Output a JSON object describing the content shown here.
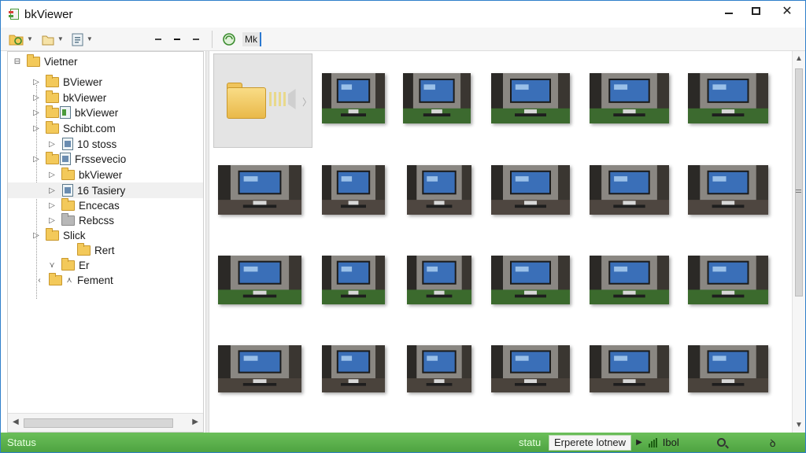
{
  "window": {
    "title": "bkViewer",
    "controls": {
      "close": "✕"
    }
  },
  "toolbar": {
    "address": "Mk"
  },
  "tree": {
    "items": [
      {
        "label": "Vietner",
        "icon": "folder"
      },
      {
        "label": "BViewer",
        "icon": "folder"
      },
      {
        "label": "bkViewer",
        "icon": "folder"
      },
      {
        "label": "bkViewer",
        "icon": "file"
      },
      {
        "label": "Schibt.com",
        "icon": "folder"
      },
      {
        "label": "10 stoss",
        "icon": "file"
      },
      {
        "label": "Frssevecio",
        "icon": "file"
      },
      {
        "label": "bkViewer",
        "icon": "folder"
      },
      {
        "label": "16 Tasiery",
        "icon": "file"
      },
      {
        "label": "Encecas",
        "icon": "folder"
      },
      {
        "label": "Rebcss",
        "icon": "folder"
      },
      {
        "label": "Slick",
        "icon": "folder"
      },
      {
        "label": "Rert",
        "icon": "folder"
      },
      {
        "label": "Er",
        "icon": "folder"
      },
      {
        "label": "Fement",
        "icon": "folder"
      }
    ]
  },
  "thumbnails": {
    "count": 24,
    "first_is_folder": true,
    "accent": "#3a6fb8"
  },
  "statusbar": {
    "left": "Status",
    "right_label": "statu",
    "field": "Erperete lotnew",
    "zoom": "Ibol",
    "pin": "ꝺ",
    "grip": "|||"
  },
  "colors": {
    "title_border": "#2f7fca",
    "status_green": "#5cb24c",
    "folder_yellow": "#f3c95a"
  }
}
